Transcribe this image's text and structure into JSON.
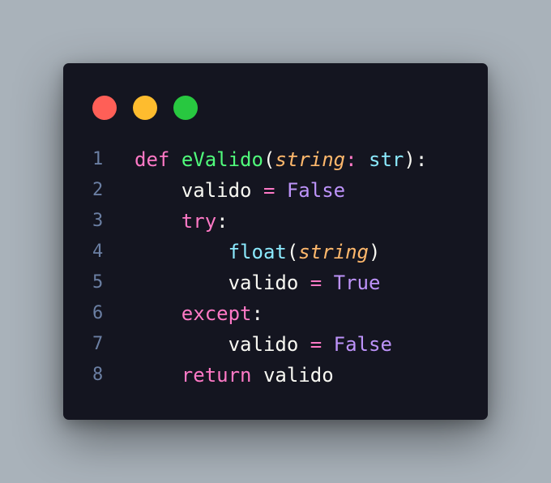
{
  "theme": {
    "background": "#a9b2ba",
    "window_bg": "#141520",
    "dot_red": "#ff5f57",
    "dot_yellow": "#febc2e",
    "dot_green": "#28c840",
    "line_number": "#6b7fa3",
    "keyword": "#ff79c6",
    "function_name": "#50fa7b",
    "param": "#ffb86c",
    "builtin": "#8be9fd",
    "constant": "#bd93f9",
    "plain": "#f8f8f2"
  },
  "code": {
    "lines": [
      {
        "number": "1",
        "tokens": [
          {
            "text": "def",
            "role": "keyword"
          },
          {
            "text": " ",
            "role": "plain"
          },
          {
            "text": "eValido",
            "role": "function_name"
          },
          {
            "text": "(",
            "role": "plain"
          },
          {
            "text": "string",
            "role": "param",
            "italic": true
          },
          {
            "text": ":",
            "role": "keyword"
          },
          {
            "text": " ",
            "role": "plain"
          },
          {
            "text": "str",
            "role": "builtin"
          },
          {
            "text": "):",
            "role": "plain"
          }
        ]
      },
      {
        "number": "2",
        "tokens": [
          {
            "text": "    ",
            "role": "plain"
          },
          {
            "text": "valido",
            "role": "plain"
          },
          {
            "text": " ",
            "role": "plain"
          },
          {
            "text": "=",
            "role": "keyword"
          },
          {
            "text": " ",
            "role": "plain"
          },
          {
            "text": "False",
            "role": "constant"
          }
        ]
      },
      {
        "number": "3",
        "tokens": [
          {
            "text": "    ",
            "role": "plain"
          },
          {
            "text": "try",
            "role": "keyword"
          },
          {
            "text": ":",
            "role": "plain"
          }
        ]
      },
      {
        "number": "4",
        "tokens": [
          {
            "text": "        ",
            "role": "plain"
          },
          {
            "text": "float",
            "role": "builtin"
          },
          {
            "text": "(",
            "role": "plain"
          },
          {
            "text": "string",
            "role": "param",
            "italic": true
          },
          {
            "text": ")",
            "role": "plain"
          }
        ]
      },
      {
        "number": "5",
        "tokens": [
          {
            "text": "        ",
            "role": "plain"
          },
          {
            "text": "valido",
            "role": "plain"
          },
          {
            "text": " ",
            "role": "plain"
          },
          {
            "text": "=",
            "role": "keyword"
          },
          {
            "text": " ",
            "role": "plain"
          },
          {
            "text": "True",
            "role": "constant"
          }
        ]
      },
      {
        "number": "6",
        "tokens": [
          {
            "text": "    ",
            "role": "plain"
          },
          {
            "text": "except",
            "role": "keyword"
          },
          {
            "text": ":",
            "role": "plain"
          }
        ]
      },
      {
        "number": "7",
        "tokens": [
          {
            "text": "        ",
            "role": "plain"
          },
          {
            "text": "valido",
            "role": "plain"
          },
          {
            "text": " ",
            "role": "plain"
          },
          {
            "text": "=",
            "role": "keyword"
          },
          {
            "text": " ",
            "role": "plain"
          },
          {
            "text": "False",
            "role": "constant"
          }
        ]
      },
      {
        "number": "8",
        "tokens": [
          {
            "text": "    ",
            "role": "plain"
          },
          {
            "text": "return",
            "role": "keyword"
          },
          {
            "text": " ",
            "role": "plain"
          },
          {
            "text": "valido",
            "role": "plain"
          }
        ]
      }
    ]
  }
}
